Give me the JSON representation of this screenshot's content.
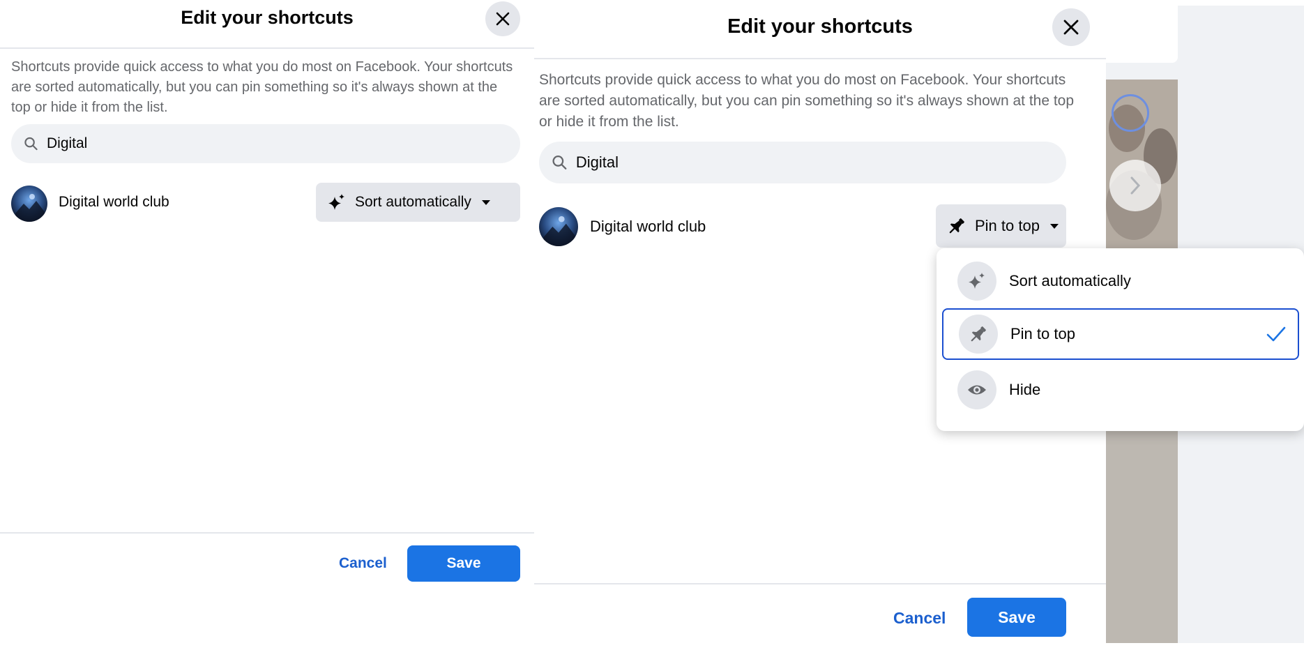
{
  "left": {
    "title": "Edit your shortcuts",
    "description": "Shortcuts provide quick access to what you do most on Facebook. Your shortcuts are sorted automatically, but you can pin something so it's always shown at the top or hide it from the list.",
    "search_value": "Digital",
    "item_name": "Digital world club",
    "mode_label": "Sort automatically",
    "cancel_label": "Cancel",
    "save_label": "Save"
  },
  "right": {
    "title": "Edit your shortcuts",
    "description": "Shortcuts provide quick access to what you do most on Facebook. Your shortcuts are sorted automatically, but you can pin something so it's always shown at the top or hide it from the list.",
    "search_value": "Digital",
    "item_name": "Digital world club",
    "mode_label": "Pin to top",
    "cancel_label": "Cancel",
    "save_label": "Save",
    "menu": [
      {
        "label": "Sort automatically",
        "icon": "sparkle-icon",
        "selected": false
      },
      {
        "label": "Pin to top",
        "icon": "pin-icon",
        "selected": true
      },
      {
        "label": "Hide",
        "icon": "eye-icon",
        "selected": false
      }
    ]
  },
  "colors": {
    "accent": "#1b74e4",
    "link": "#1b5fce",
    "selected_border": "#1b4fd0",
    "button_bg": "#e4e6eb",
    "search_bg": "#f0f2f5"
  }
}
